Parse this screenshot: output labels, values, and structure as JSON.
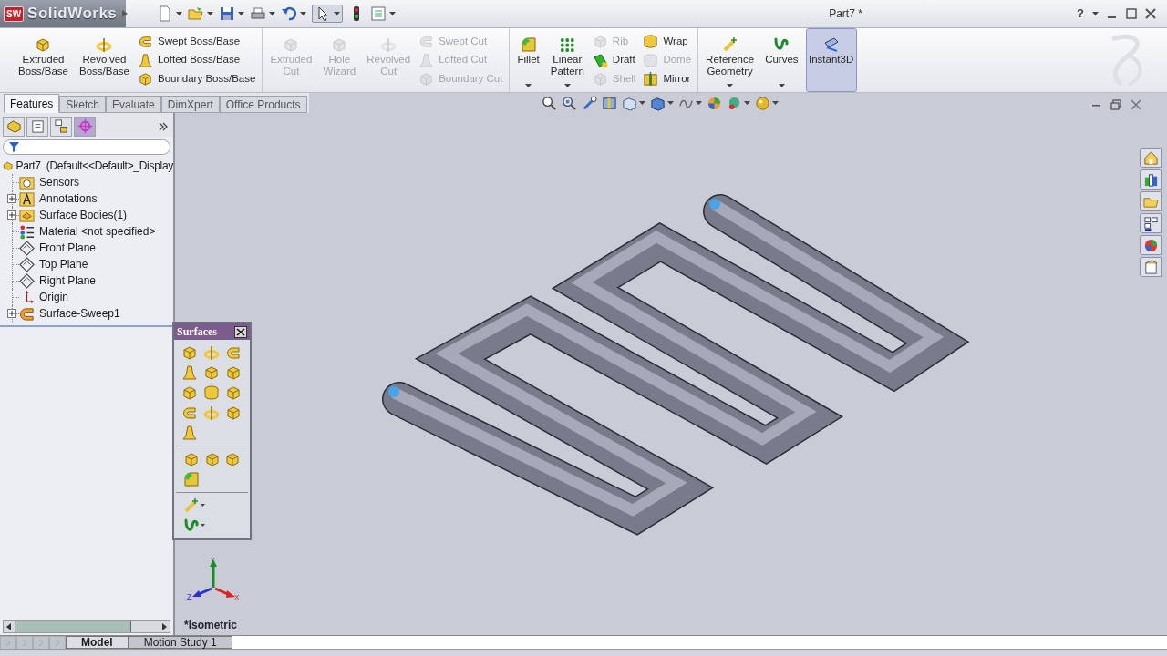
{
  "app": {
    "logo_badge": "SW",
    "logo": "SolidWorks",
    "title": "Part7 *",
    "help": "?"
  },
  "ribbon": {
    "groups": [
      [
        {
          "kind": "large",
          "lines": [
            "Extruded",
            "Boss/Base"
          ],
          "disabled": false,
          "dropdown": false,
          "on": false
        },
        {
          "kind": "large",
          "lines": [
            "Revolved",
            "Boss/Base"
          ],
          "disabled": false,
          "dropdown": false,
          "on": false
        },
        {
          "kind": "stack",
          "items": [
            {
              "label": "Swept Boss/Base",
              "disabled": false
            },
            {
              "label": "Lofted Boss/Base",
              "disabled": false
            },
            {
              "label": "Boundary Boss/Base",
              "disabled": false
            }
          ]
        }
      ],
      [
        {
          "kind": "large",
          "lines": [
            "Extruded",
            "Cut"
          ],
          "disabled": true,
          "dropdown": false,
          "on": false
        },
        {
          "kind": "large",
          "lines": [
            "Hole",
            "Wizard"
          ],
          "disabled": true,
          "dropdown": false,
          "on": false
        },
        {
          "kind": "large",
          "lines": [
            "Revolved",
            "Cut"
          ],
          "disabled": true,
          "dropdown": false,
          "on": false
        },
        {
          "kind": "stack",
          "items": [
            {
              "label": "Swept Cut",
              "disabled": true
            },
            {
              "label": "Lofted Cut",
              "disabled": true
            },
            {
              "label": "Boundary Cut",
              "disabled": true
            }
          ]
        }
      ],
      [
        {
          "kind": "large",
          "lines": [
            "Fillet"
          ],
          "disabled": false,
          "dropdown": true,
          "on": false
        },
        {
          "kind": "large",
          "lines": [
            "Linear",
            "Pattern"
          ],
          "disabled": false,
          "dropdown": true,
          "on": false
        },
        {
          "kind": "stack",
          "items": [
            {
              "label": "Rib",
              "disabled": true
            },
            {
              "label": "Draft",
              "disabled": false
            },
            {
              "label": "Shell",
              "disabled": true
            }
          ]
        },
        {
          "kind": "stack",
          "items": [
            {
              "label": "Wrap",
              "disabled": false
            },
            {
              "label": "Dome",
              "disabled": true
            },
            {
              "label": "Mirror",
              "disabled": false
            }
          ]
        }
      ],
      [
        {
          "kind": "large",
          "lines": [
            "Reference",
            "Geometry"
          ],
          "disabled": false,
          "dropdown": true,
          "on": false
        },
        {
          "kind": "large",
          "lines": [
            "Curves"
          ],
          "disabled": false,
          "dropdown": true,
          "on": false
        },
        {
          "kind": "large",
          "lines": [
            "Instant3D"
          ],
          "disabled": false,
          "dropdown": false,
          "on": true
        }
      ]
    ]
  },
  "panel_tabs": [
    {
      "selected": false
    },
    {
      "selected": false
    },
    {
      "selected": false
    },
    {
      "selected": true
    }
  ],
  "tabs": [
    {
      "label": "Features",
      "selected": true
    },
    {
      "label": "Sketch",
      "selected": false
    },
    {
      "label": "Evaluate",
      "selected": false
    },
    {
      "label": "DimXpert",
      "selected": false
    },
    {
      "label": "Office Products",
      "selected": false
    }
  ],
  "feature_tree": {
    "root": {
      "label": "Part7  (Default<<Default>_Display",
      "children": [
        {
          "label": "Sensors",
          "expandable": false
        },
        {
          "label": "Annotations",
          "expandable": true
        },
        {
          "label": "Surface Bodies(1)",
          "expandable": true
        },
        {
          "label": "Material <not specified>",
          "expandable": false
        },
        {
          "label": "Front Plane",
          "expandable": false
        },
        {
          "label": "Top Plane",
          "expandable": false
        },
        {
          "label": "Right Plane",
          "expandable": false
        },
        {
          "label": "Origin",
          "expandable": false
        },
        {
          "label": "Surface-Sweep1",
          "expandable": true
        }
      ]
    }
  },
  "surfaces_toolbar": {
    "title": "Surfaces",
    "sections": [
      [
        {
          "dropdown": false
        },
        {
          "dropdown": false
        },
        {
          "dropdown": false
        },
        {
          "dropdown": false
        },
        {
          "dropdown": false
        },
        {
          "dropdown": false
        },
        {
          "dropdown": false
        },
        {
          "dropdown": false
        },
        {
          "dropdown": false
        },
        {
          "dropdown": false
        },
        {
          "dropdown": false
        },
        {
          "dropdown": false
        },
        {
          "dropdown": false
        }
      ],
      [
        {
          "dropdown": false
        },
        {
          "dropdown": false
        },
        {
          "dropdown": false
        },
        {
          "dropdown": false
        }
      ],
      [
        {
          "dropdown": true
        },
        {
          "dropdown": true
        }
      ]
    ]
  },
  "viewport": {
    "view_name": "*Isometric",
    "triad": {
      "y": "Y",
      "z": "Z",
      "x": "X"
    }
  },
  "bottom_tabs": [
    {
      "label": "Model",
      "selected": true
    },
    {
      "label": "Motion Study 1",
      "selected": false
    }
  ]
}
